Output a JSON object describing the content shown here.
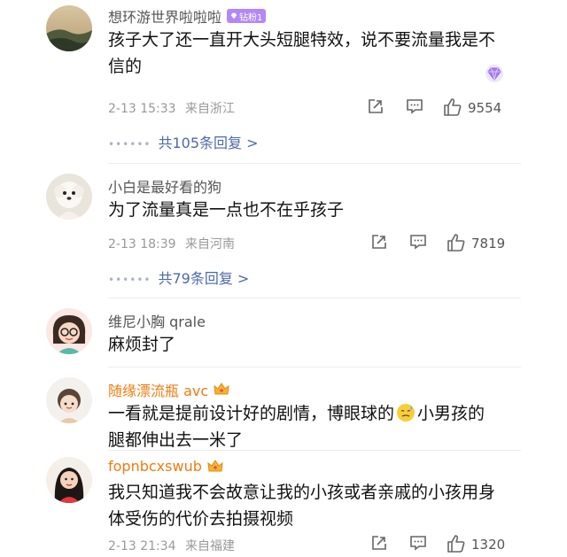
{
  "comments": [
    {
      "username": "想环游世界啦啦啦",
      "badge": "钻粉1",
      "text": "孩子大了还一直开大头短腿特效，说不要流量我是不信的",
      "date": "2-13 15:33",
      "location": "来自浙江",
      "likes": "9554",
      "replies": "共105条回复 >"
    },
    {
      "username": "小白是最好看的狗",
      "text": "为了流量真是一点也不在乎孩子",
      "date": "2-13 18:39",
      "location": "来自河南",
      "likes": "7819",
      "replies": "共79条回复 >"
    },
    {
      "username": "维尼小胸 qrale",
      "text": "麻烦封了"
    },
    {
      "username": "随缘漂流瓶 avc",
      "text_part1": "一看就是提前设计好的剧情，博眼球的",
      "text_part2": "小男孩的腿都伸出去一米了"
    },
    {
      "username": "fopnbcxswub",
      "text": "我只知道我不会故意让我的小孩或者亲戚的小孩用身体受伤的代价去拍摄视频",
      "date": "2-13 21:34",
      "location": "来自福建",
      "likes": "1320"
    }
  ],
  "icons": {
    "share": "share-icon",
    "comment": "comment-icon",
    "like": "thumbs-up-icon",
    "crown": "crown-icon",
    "diamond": "diamond-icon"
  },
  "colors": {
    "name_gray": "#555555",
    "name_orange": "#f07b10",
    "reply_link": "#4b6aa8",
    "badge_purple": "#b388f5",
    "meta_gray": "#999999"
  }
}
